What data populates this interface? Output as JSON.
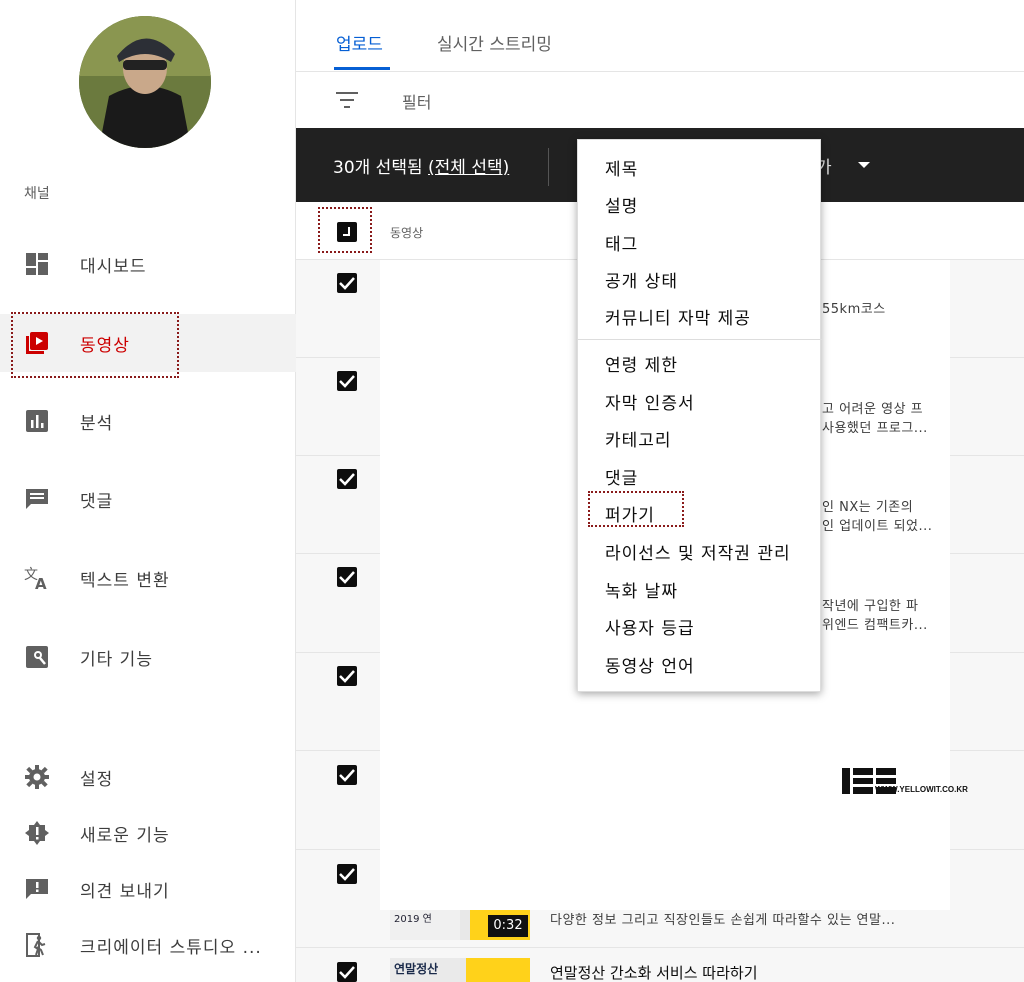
{
  "sidebar": {
    "channel_label": "채널",
    "items": [
      {
        "label": "대시보드",
        "icon": "dashboard-icon"
      },
      {
        "label": "동영상",
        "icon": "video-icon"
      },
      {
        "label": "분석",
        "icon": "analytics-icon"
      },
      {
        "label": "댓글",
        "icon": "comment-icon"
      },
      {
        "label": "텍스트 변환",
        "icon": "translate-icon"
      },
      {
        "label": "기타 기능",
        "icon": "other-features-icon"
      }
    ],
    "bottom_items": [
      {
        "label": "설정",
        "icon": "gear-icon"
      },
      {
        "label": "새로운 기능",
        "icon": "new-features-icon"
      },
      {
        "label": "의견 보내기",
        "icon": "feedback-icon"
      },
      {
        "label": "크리에이터 스튜디오 ...",
        "icon": "classic-studio-icon"
      }
    ],
    "active_index": 1,
    "accent_color": "#cc0000"
  },
  "tabs": [
    {
      "label": "업로드",
      "active": true
    },
    {
      "label": "실시간 스트리밍",
      "active": false
    }
  ],
  "filter": {
    "label": "필터",
    "icon": "filter-icon"
  },
  "action_bar": {
    "selected_count": "30개 선택됨 ",
    "select_all": "(전체 선택)",
    "partial_text": "가"
  },
  "column_header": {
    "label": "동영상"
  },
  "rows": [
    {
      "desc_lines": [
        "55km코스"
      ]
    },
    {
      "desc_lines": [
        "고 어려운 영상 프",
        "사용했던 프로그..."
      ]
    },
    {
      "desc_lines": [
        "인 NX는 기존의",
        "인 업데이트 되었..."
      ]
    },
    {
      "desc_lines": [
        "작년에 구입한 파",
        "위엔드 컴팩트카..."
      ]
    },
    {
      "desc_lines": []
    },
    {
      "desc_lines": []
    },
    {
      "desc_lines": [
        "다양한 정보 그리고 직장인들도 손쉽게 따라할수 있는 연말..."
      ],
      "duration": "0:32"
    },
    {
      "desc_lines": [
        "연말정산 간소화 서비스 따라하기"
      ]
    }
  ],
  "menu": {
    "group1": [
      "제목",
      "설명",
      "태그",
      "공개 상태",
      "커뮤니티 자막 제공"
    ],
    "group2": [
      "연령 제한",
      "자막 인증서",
      "카테고리",
      "댓글",
      "퍼가기",
      "라이선스 및 저작권 관리",
      "녹화 날짜",
      "사용자 등급",
      "동영상 언어"
    ]
  },
  "watermark": {
    "text": "WWW.YELLOWIT.CO.KR"
  },
  "thumb_text": {
    "top": "2019 연",
    "bottom": "연말정산"
  }
}
